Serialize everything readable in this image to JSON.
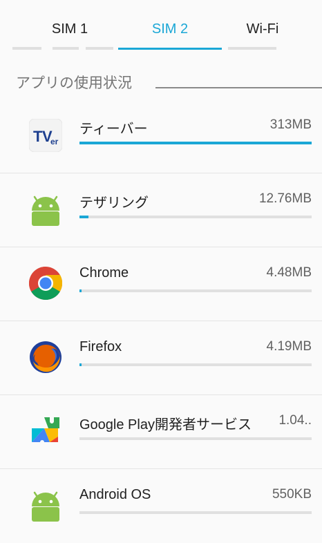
{
  "tabs": [
    {
      "label": "SIM 1",
      "active": false
    },
    {
      "label": "SIM 2",
      "active": true
    },
    {
      "label": "Wi-Fi",
      "active": false
    }
  ],
  "section_title": "アプリの使用状況",
  "colors": {
    "accent": "#1aa7d6",
    "track": "#e0e0e0"
  },
  "apps": [
    {
      "name": "ティーバー",
      "size": "313MB",
      "usage_fraction": 1.0,
      "icon": "tver-icon"
    },
    {
      "name": "テザリング",
      "size": "12.76MB",
      "usage_fraction": 0.04,
      "icon": "android-icon"
    },
    {
      "name": "Chrome",
      "size": "4.48MB",
      "usage_fraction": 0.01,
      "icon": "chrome-icon"
    },
    {
      "name": "Firefox",
      "size": "4.19MB",
      "usage_fraction": 0.01,
      "icon": "firefox-icon"
    },
    {
      "name": "Google Play開発者サービス",
      "size": "1.04..",
      "usage_fraction": 0.0,
      "icon": "google-play-services-icon"
    },
    {
      "name": "Android OS",
      "size": "550KB",
      "usage_fraction": 0.0,
      "icon": "android-icon"
    }
  ]
}
